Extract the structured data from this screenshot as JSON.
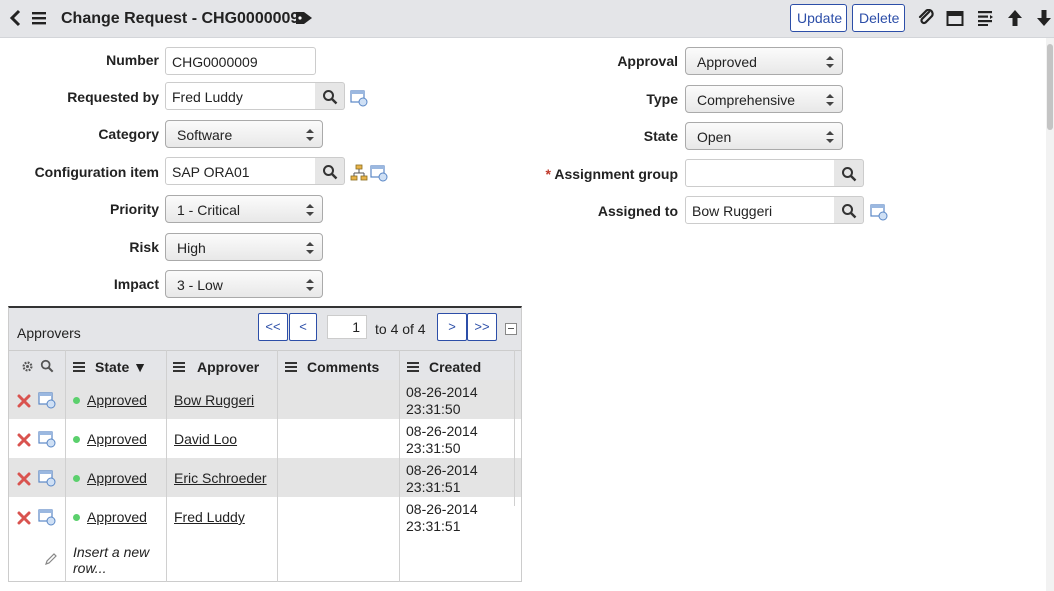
{
  "header": {
    "title": "Change Request - CHG0000009",
    "update_label": "Update",
    "delete_label": "Delete",
    "icons": [
      "back-icon",
      "menu-icon",
      "tag-icon",
      "paperclip-icon",
      "calendar-icon",
      "more-options-icon",
      "up-arrow-icon",
      "down-arrow-icon"
    ]
  },
  "form": {
    "number": {
      "label": "Number",
      "value": "CHG0000009"
    },
    "requested_by": {
      "label": "Requested by",
      "value": "Fred Luddy"
    },
    "category": {
      "label": "Category",
      "value": "Software"
    },
    "configuration_item": {
      "label": "Configuration item",
      "value": "SAP ORA01"
    },
    "priority": {
      "label": "Priority",
      "value": "1 - Critical"
    },
    "risk": {
      "label": "Risk",
      "value": "High"
    },
    "impact": {
      "label": "Impact",
      "value": "3 - Low"
    },
    "approval": {
      "label": "Approval",
      "value": "Approved"
    },
    "type": {
      "label": "Type",
      "value": "Comprehensive"
    },
    "state": {
      "label": "State",
      "value": "Open"
    },
    "assignment_group": {
      "label": "Assignment group",
      "required_mark": "*",
      "value": ""
    },
    "assigned_to": {
      "label": "Assigned to",
      "value": "Bow Ruggeri"
    }
  },
  "approvers": {
    "title": "Approvers",
    "pager": {
      "first": "<<",
      "prev": "<",
      "current": "1",
      "of_text": "to 4 of 4",
      "next": ">",
      "last": ">>"
    },
    "columns": {
      "state": "State ▼",
      "approver": "Approver",
      "comments": "Comments",
      "created": "Created"
    },
    "rows": [
      {
        "state": "Approved",
        "approver": "Bow Ruggeri",
        "comments": "",
        "created_date": "08-26-2014",
        "created_time": "23:31:50"
      },
      {
        "state": "Approved",
        "approver": "David Loo",
        "comments": "",
        "created_date": "08-26-2014",
        "created_time": "23:31:50"
      },
      {
        "state": "Approved",
        "approver": "Eric Schroeder",
        "comments": "",
        "created_date": "08-26-2014",
        "created_time": "23:31:51"
      },
      {
        "state": "Approved",
        "approver": "Fred Luddy",
        "comments": "",
        "created_date": "08-26-2014",
        "created_time": "23:31:51"
      }
    ],
    "insert_row_line1": "Insert a new",
    "insert_row_line2": "row..."
  },
  "colors": {
    "accent": "#2c4ea8",
    "status_green": "#5bd06d",
    "delete_red": "#d9534f",
    "header_bg": "#e4e5e8"
  }
}
